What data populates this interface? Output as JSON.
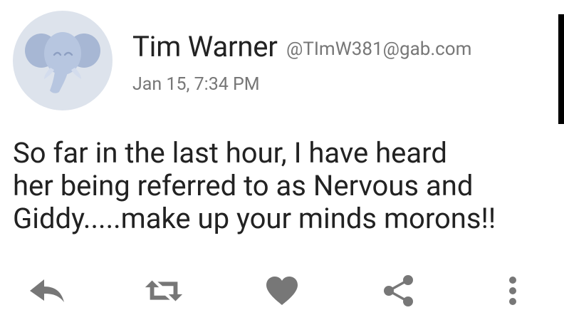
{
  "post": {
    "author": {
      "display_name": "Tim Warner",
      "handle": "@TImW381@gab.com",
      "avatar_icon": "elephant-icon"
    },
    "timestamp": "Jan 15, 7:34 PM",
    "body_lines": [
      "So far in the last hour, I have heard",
      "her being referred to as Nervous and",
      "Giddy.....make up your minds morons!!"
    ]
  },
  "actions": {
    "reply_icon": "reply-icon",
    "repost_icon": "repost-icon",
    "like_icon": "heart-icon",
    "share_icon": "share-icon",
    "more_icon": "more-vertical-icon"
  },
  "colors": {
    "text_primary": "#222222",
    "text_secondary": "#777777",
    "icon_gray": "#777777",
    "avatar_bg": "#dde3ec",
    "elephant_blue": "#aabbd8"
  }
}
